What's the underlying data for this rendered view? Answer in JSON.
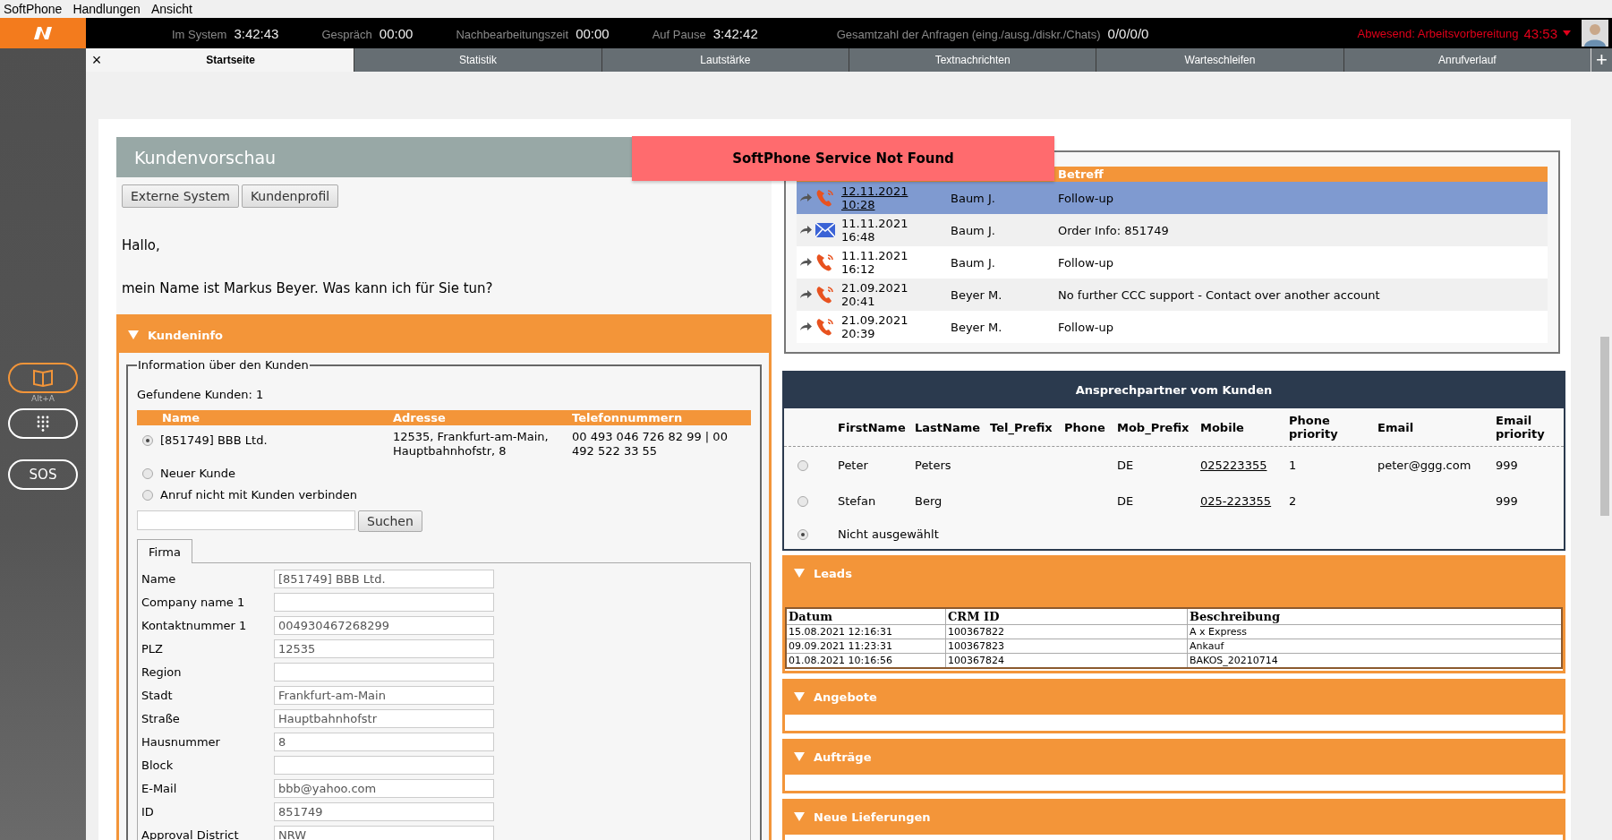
{
  "menu": [
    "SoftPhone",
    "Handlungen",
    "Ansicht"
  ],
  "status": [
    {
      "label": "Im System",
      "value": "3:42:43"
    },
    {
      "label": "Gespräch",
      "value": "00:00"
    },
    {
      "label": "Nachbearbeitungszeit",
      "value": "00:00"
    },
    {
      "label": "Auf Pause",
      "value": "3:42:42"
    },
    {
      "label": "Gesamtzahl der Anfragen (eing./ausg./diskr./Chats)",
      "value": "0/0/0/0"
    }
  ],
  "away": {
    "label": "Abwesend: Arbeitsvorbereitung",
    "time": "43:53"
  },
  "tab_close": "×",
  "tabs": [
    {
      "label": "Startseite",
      "selected": true
    },
    {
      "label": "Statistik",
      "selected": false
    },
    {
      "label": "Lautstärke",
      "selected": false
    },
    {
      "label": "Textnachrichten",
      "selected": false
    },
    {
      "label": "Warteschleifen",
      "selected": false
    },
    {
      "label": "Anrufverlauf",
      "selected": false
    }
  ],
  "tab_add": "+",
  "sidebar": {
    "shortcut": "Alt+A",
    "sos": "SOS"
  },
  "preview": {
    "title": "Kundenvorschau",
    "buttons": [
      "Externe System",
      "Kundenprofil"
    ],
    "greeting": "Hallo,",
    "message": "mein Name ist Markus Beyer. Was kann ich für Sie tun?"
  },
  "kundeninfo": {
    "title": "Kundeninfo",
    "expanded": true,
    "legend": "Information über den Kunden",
    "found": "Gefundene Kunden: 1",
    "columns": [
      "Name",
      "Adresse",
      "Telefonnummern"
    ],
    "options": [
      {
        "name": "[851749] BBB Ltd.",
        "address": "12535, Frankfurt-am-Main, Hauptbahnhofstr, 8",
        "phones": "00 493 046 726 82 99 | 00 492 522 33 55",
        "selected": true
      },
      {
        "name": "Neuer Kunde",
        "selected": false
      },
      {
        "name": "Anruf nicht mit Kunden verbinden",
        "selected": false
      }
    ],
    "search_button": "Suchen",
    "form_tab": "Firma",
    "fields": [
      {
        "label": "Name",
        "value": "[851749] BBB Ltd."
      },
      {
        "label": "Company name 1"
      },
      {
        "label": "Kontaktnummer 1",
        "value": "004930467268299"
      },
      {
        "label": "PLZ",
        "value": "12535"
      },
      {
        "label": "Region"
      },
      {
        "label": "Stadt",
        "value": "Frankfurt-am-Main"
      },
      {
        "label": "Straße",
        "value": "Hauptbahnhofstr"
      },
      {
        "label": "Hausnummer",
        "value": "8"
      },
      {
        "label": "Block"
      },
      {
        "label": "E-Mail",
        "value": "bbb@yahoo.com"
      },
      {
        "label": "ID",
        "value": "851749"
      },
      {
        "label": "Approval District",
        "value": "NRW"
      }
    ]
  },
  "error_banner": "SoftPhone Service Not Found",
  "history": {
    "header": "Betreff",
    "rows": [
      {
        "kind": "call",
        "date": "12.11.2021",
        "time": "10:28",
        "agent": "Baum J.",
        "subject": "Follow-up",
        "selected": true
      },
      {
        "kind": "email",
        "date": "11.11.2021",
        "time": "16:48",
        "agent": "Baum J.",
        "subject": "Order Info: 851749",
        "selected": false
      },
      {
        "kind": "call",
        "date": "11.11.2021",
        "time": "16:12",
        "agent": "Baum J.",
        "subject": "Follow-up",
        "selected": false
      },
      {
        "kind": "call",
        "date": "21.09.2021",
        "time": "20:41",
        "agent": "Beyer M.",
        "subject": "No further CCC support - Contact over another account",
        "selected": false
      },
      {
        "kind": "call",
        "date": "21.09.2021",
        "time": "20:39",
        "agent": "Beyer M.",
        "subject": "Follow-up",
        "selected": false
      }
    ]
  },
  "contacts": {
    "title": "Ansprechpartner vom Kunden",
    "columns": [
      "FirstName",
      "LastName",
      "Tel_Prefix",
      "Phone",
      "Mob_Prefix",
      "Mobile",
      "Phone priority",
      "Email",
      "Email priority"
    ],
    "rows": [
      {
        "first": "Peter",
        "last": "Peters",
        "mob_prefix": "DE",
        "mobile": "025223355",
        "phone_priority": "1",
        "email": "peter@ggg.com",
        "email_priority": "999",
        "selected": false
      },
      {
        "first": "Stefan",
        "last": "Berg",
        "mob_prefix": "DE",
        "mobile": "025-223355",
        "phone_priority": "2",
        "email_priority": "999",
        "selected": false
      }
    ],
    "none": {
      "label": "Nicht ausgewählt",
      "selected": true
    }
  },
  "sections": [
    {
      "title": "Leads",
      "expanded": true,
      "table": {
        "columns": [
          "Datum",
          "CRM ID",
          "Beschreibung"
        ],
        "rows": [
          [
            "15.08.2021 12:16:31",
            "100367822",
            "A x Express"
          ],
          [
            "09.09.2021 11:23:31",
            "100367823",
            "Ankauf"
          ],
          [
            "01.08.2021 10:16:56",
            "100367824",
            "BAKOS_20210714"
          ]
        ]
      }
    },
    {
      "title": "Angebote",
      "expanded": true
    },
    {
      "title": "Aufträge",
      "expanded": true
    },
    {
      "title": "Neue Lieferungen",
      "expanded": true
    }
  ]
}
